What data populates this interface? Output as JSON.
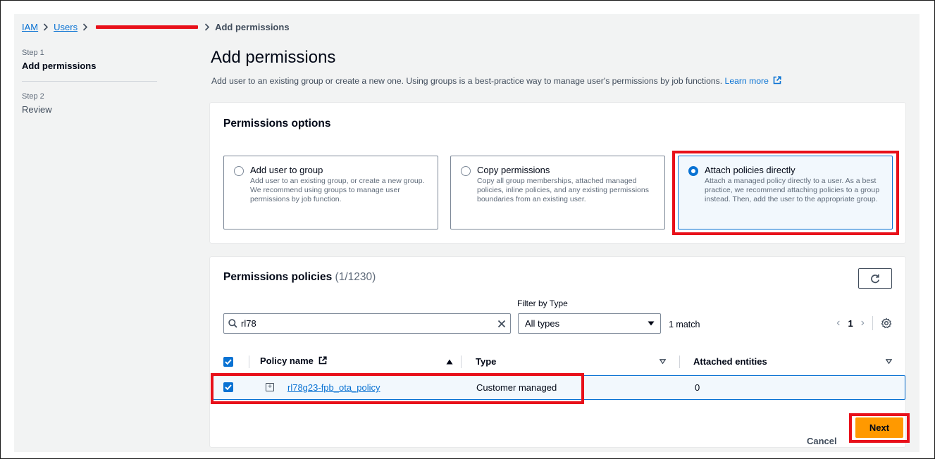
{
  "breadcrumb": {
    "iam": "IAM",
    "users": "Users",
    "current": "Add permissions"
  },
  "steps": [
    {
      "num": "Step 1",
      "title": "Add permissions"
    },
    {
      "num": "Step 2",
      "title": "Review"
    }
  ],
  "page": {
    "title": "Add permissions",
    "description": "Add user to an existing group or create a new one. Using groups is a best-practice way to manage user's permissions by job functions.",
    "learn_more": "Learn more"
  },
  "options": {
    "title": "Permissions options",
    "tiles": [
      {
        "title": "Add user to group",
        "desc": "Add user to an existing group, or create a new group. We recommend using groups to manage user permissions by job function.",
        "selected": false
      },
      {
        "title": "Copy permissions",
        "desc": "Copy all group memberships, attached managed policies, inline policies, and any existing permissions boundaries from an existing user.",
        "selected": false
      },
      {
        "title": "Attach policies directly",
        "desc": "Attach a managed policy directly to a user. As a best practice, we recommend attaching policies to a group instead. Then, add the user to the appropriate group.",
        "selected": true
      }
    ]
  },
  "policies": {
    "title": "Permissions policies",
    "count": "(1/1230)",
    "filter_label": "Filter by Type",
    "search_value": "rl78",
    "type_value": "All types",
    "match_text": "1 match",
    "page_number": "1",
    "columns": [
      "Policy name",
      "Type",
      "Attached entities"
    ],
    "rows": [
      {
        "name": "rl78g23-fpb_ota_policy",
        "type": "Customer managed",
        "entities": "0",
        "checked": true
      }
    ]
  },
  "footer": {
    "cancel": "Cancel",
    "next": "Next"
  },
  "colors": {
    "accent": "#0972d3",
    "primary_button": "#ff9900",
    "highlight": "#e8101a"
  }
}
